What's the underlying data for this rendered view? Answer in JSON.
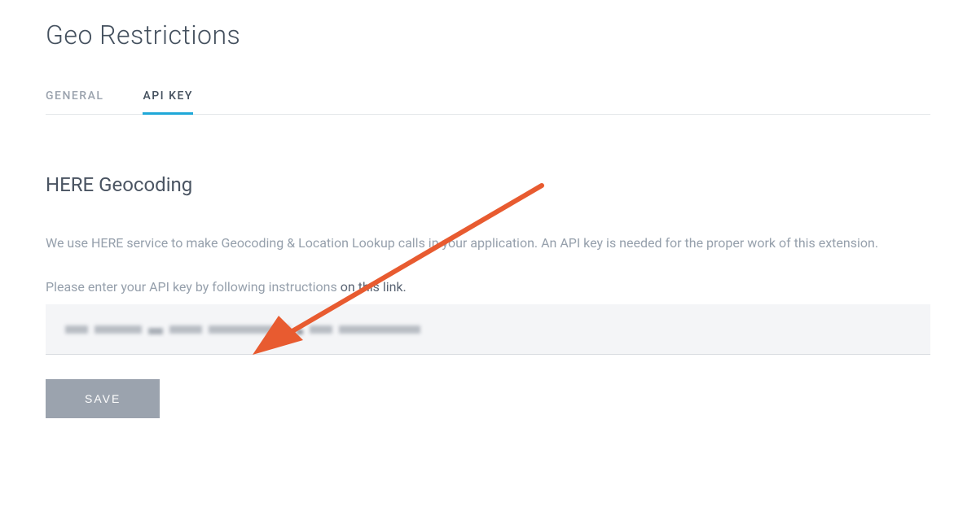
{
  "page": {
    "title": "Geo Restrictions"
  },
  "tabs": {
    "general": "General",
    "api_key": "API Key"
  },
  "section": {
    "title": "HERE Geocoding",
    "description": "We use HERE service to make Geocoding & Location Lookup calls in your application. An API key is needed for the proper work of this extension.",
    "instruction_prefix": "Please enter your API key by following instructions ",
    "instruction_link": "on this link."
  },
  "form": {
    "api_key_value": "",
    "api_key_placeholder": ""
  },
  "buttons": {
    "save": "Save"
  },
  "annotation": {
    "type": "arrow",
    "color": "#e85b30"
  }
}
